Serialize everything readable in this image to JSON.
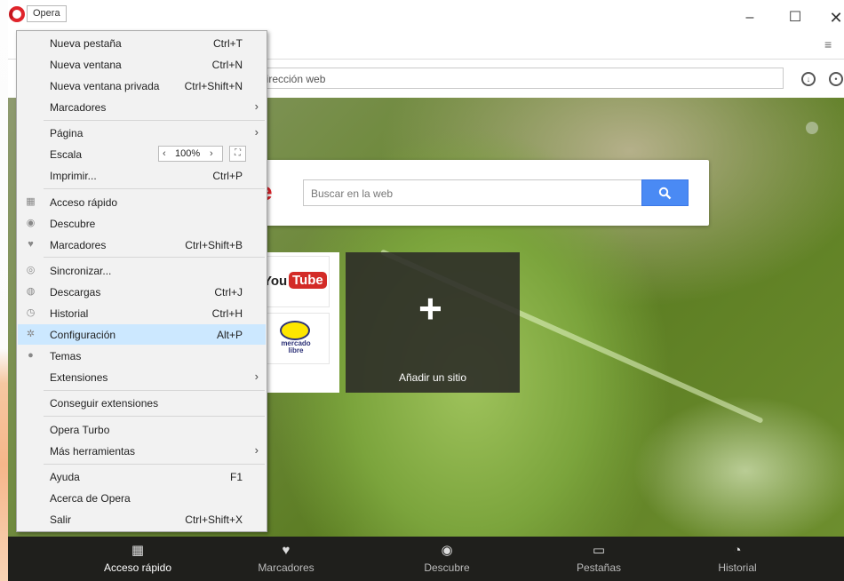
{
  "titlebar": {
    "menu_button_label": "Opera",
    "minimize": "–",
    "maximize": "☐",
    "close": "✕"
  },
  "addressbar": {
    "placeholder_text": "o dirección web"
  },
  "search": {
    "brand_glyph": "e",
    "placeholder": "Buscar en la web"
  },
  "speed_dial": {
    "youtube": {
      "part1": "You",
      "part2": "Tube"
    },
    "mercadolibre": {
      "text": "mercado libre"
    },
    "add_site_label": "Añadir un sitio",
    "add_symbol": "+"
  },
  "bottom_bar": {
    "items": [
      {
        "label": "Acceso rápido",
        "icon": "grid-icon"
      },
      {
        "label": "Marcadores",
        "icon": "heart-icon"
      },
      {
        "label": "Descubre",
        "icon": "eye-icon"
      },
      {
        "label": "Pestañas",
        "icon": "devices-icon"
      },
      {
        "label": "Historial",
        "icon": "clock-icon"
      }
    ]
  },
  "menu": {
    "items": [
      {
        "label": "Nueva pestaña",
        "shortcut": "Ctrl+T"
      },
      {
        "label": "Nueva ventana",
        "shortcut": "Ctrl+N"
      },
      {
        "label": "Nueva ventana privada",
        "shortcut": "Ctrl+Shift+N"
      },
      {
        "label": "Marcadores",
        "arrow": "›"
      },
      {
        "label": "Página",
        "arrow": "›"
      },
      {
        "label": "Escala"
      },
      {
        "label": "Imprimir...",
        "shortcut": "Ctrl+P"
      },
      {
        "label": "Acceso rápido",
        "icon": "grid-icon"
      },
      {
        "label": "Descubre",
        "icon": "eye-icon"
      },
      {
        "label": "Marcadores",
        "shortcut": "Ctrl+Shift+B",
        "icon": "heart-icon"
      },
      {
        "label": "Sincronizar...",
        "icon": "account-icon"
      },
      {
        "label": "Descargas",
        "shortcut": "Ctrl+J",
        "icon": "download-icon"
      },
      {
        "label": "Historial",
        "shortcut": "Ctrl+H",
        "icon": "clock-icon"
      },
      {
        "label": "Configuración",
        "shortcut": "Alt+P",
        "icon": "gear-icon"
      },
      {
        "label": "Temas",
        "icon": "drop-icon"
      },
      {
        "label": "Extensiones",
        "arrow": "›"
      },
      {
        "label": "Conseguir extensiones"
      },
      {
        "label": "Opera Turbo"
      },
      {
        "label": "Más herramientas",
        "arrow": "›"
      },
      {
        "label": "Ayuda",
        "shortcut": "F1"
      },
      {
        "label": "Acerca de Opera"
      },
      {
        "label": "Salir",
        "shortcut": "Ctrl+Shift+X"
      }
    ],
    "zoom": {
      "value": "100%",
      "dec": "‹",
      "inc": "›",
      "fullscreen": "⛶"
    }
  }
}
